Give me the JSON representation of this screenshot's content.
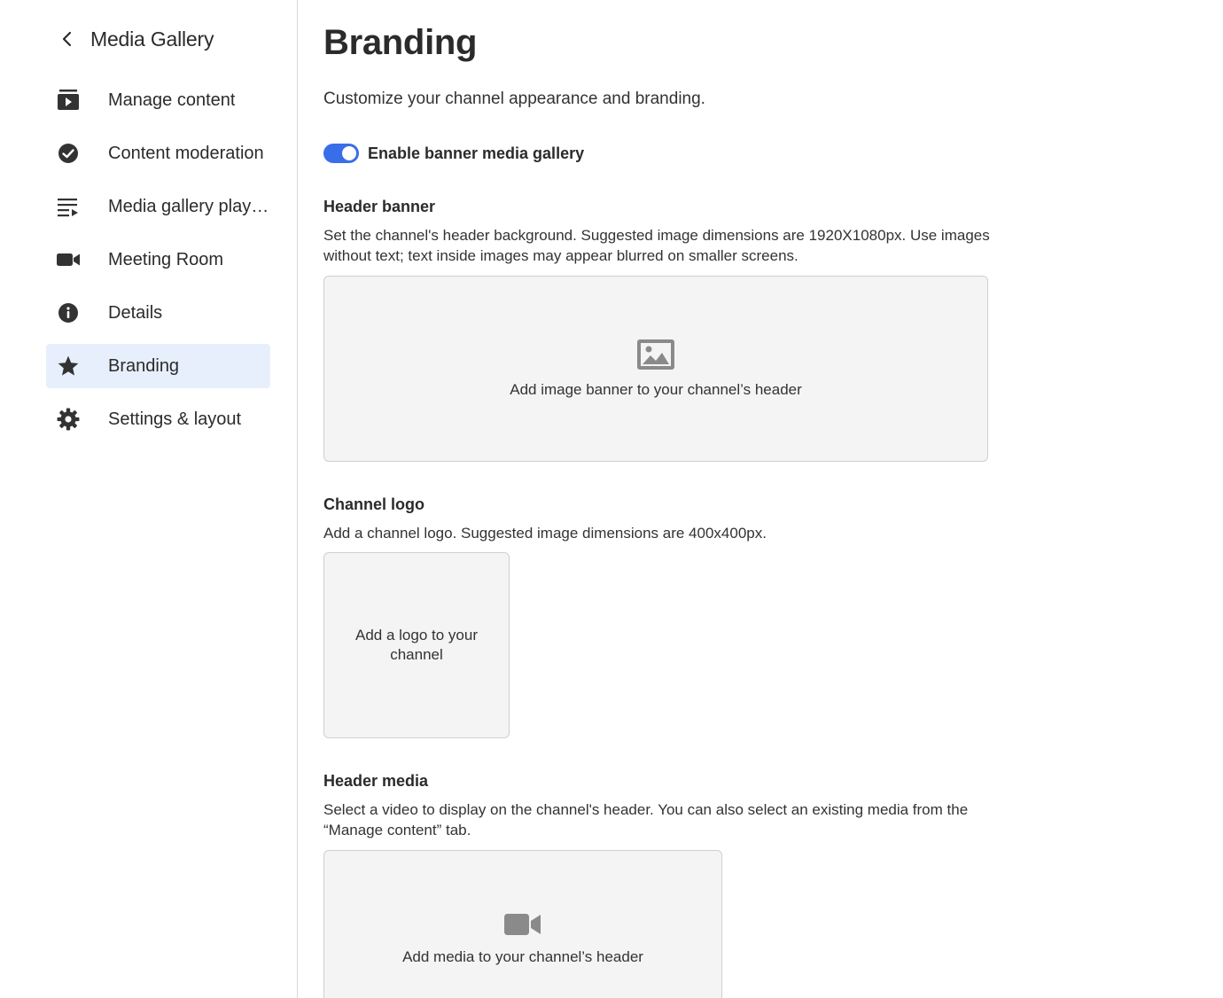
{
  "sidebar": {
    "back_title": "Media Gallery",
    "items": [
      {
        "label": "Manage content",
        "icon": "manage-content-icon",
        "active": false
      },
      {
        "label": "Content moderation",
        "icon": "check-circle-icon",
        "active": false
      },
      {
        "label": "Media gallery playlists",
        "icon": "playlist-icon",
        "active": false
      },
      {
        "label": "Meeting Room",
        "icon": "video-camera-icon",
        "active": false
      },
      {
        "label": "Details",
        "icon": "info-icon",
        "active": false
      },
      {
        "label": "Branding",
        "icon": "star-icon",
        "active": true
      },
      {
        "label": "Settings & layout",
        "icon": "gear-icon",
        "active": false
      }
    ]
  },
  "main": {
    "title": "Branding",
    "subtitle": "Customize your channel appearance and branding.",
    "toggle": {
      "label": "Enable banner media gallery",
      "enabled": true
    },
    "header_banner": {
      "title": "Header banner",
      "description": "Set the channel's header background. Suggested image dimensions are 1920X1080px. Use images without text; text inside images may appear blurred on smaller screens.",
      "dropzone_text": "Add image banner to your channel’s header"
    },
    "channel_logo": {
      "title": "Channel logo",
      "description": "Add a channel logo. Suggested image dimensions are 400x400px.",
      "dropzone_text": "Add a logo to your channel"
    },
    "header_media": {
      "title": "Header media",
      "description": "Select a video to display on the channel's header. You can also select an existing media from the “Manage content” tab.",
      "dropzone_text": "Add media to your channel’s header"
    }
  },
  "colors": {
    "accent": "#3a6ee8",
    "active_nav_bg": "#e8effc",
    "dropzone_bg": "#f4f4f4",
    "icon_gray": "#8a8a8a"
  }
}
